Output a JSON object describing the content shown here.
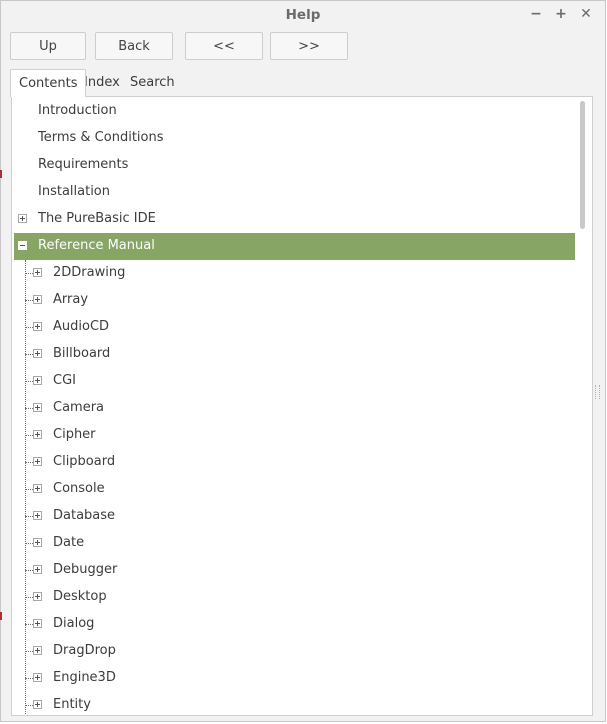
{
  "window": {
    "title": "Help"
  },
  "window_controls": {
    "minimize": "−",
    "maximize": "+",
    "close": "✕"
  },
  "toolbar": {
    "up": "Up",
    "back": "Back",
    "prev": "<<",
    "next": ">>"
  },
  "tabs": [
    {
      "label": "Contents"
    },
    {
      "label": "Index"
    },
    {
      "label": "Search"
    }
  ],
  "tree": {
    "top_items": [
      {
        "label": "Introduction"
      },
      {
        "label": "Terms & Conditions"
      },
      {
        "label": "Requirements"
      },
      {
        "label": "Installation"
      },
      {
        "label": "The PureBasic IDE"
      },
      {
        "label": "Reference Manual"
      }
    ],
    "children": [
      {
        "label": "2DDrawing"
      },
      {
        "label": "Array"
      },
      {
        "label": "AudioCD"
      },
      {
        "label": "Billboard"
      },
      {
        "label": "CGI"
      },
      {
        "label": "Camera"
      },
      {
        "label": "Cipher"
      },
      {
        "label": "Clipboard"
      },
      {
        "label": "Console"
      },
      {
        "label": "Database"
      },
      {
        "label": "Date"
      },
      {
        "label": "Debugger"
      },
      {
        "label": "Desktop"
      },
      {
        "label": "Dialog"
      },
      {
        "label": "DragDrop"
      },
      {
        "label": "Engine3D"
      },
      {
        "label": "Entity"
      }
    ]
  },
  "colors": {
    "selection": "#87a564",
    "selection_text": "#ffffff"
  }
}
